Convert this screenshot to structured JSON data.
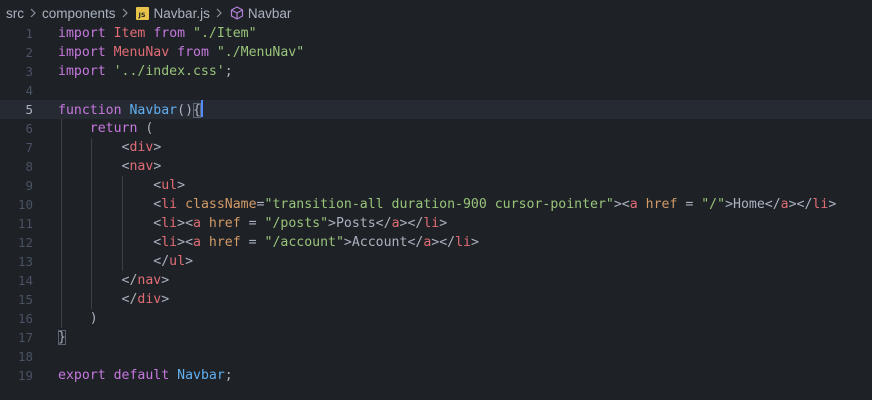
{
  "breadcrumb": {
    "segments": [
      "src",
      "components",
      "Navbar.js",
      "Navbar"
    ],
    "file_icon_text": "JS",
    "file_icon_name": "javascript-file-icon",
    "symbol_icon_name": "component-cube-icon"
  },
  "colors": {
    "background": "#1e2227",
    "keyword": "#c678dd",
    "function": "#61afef",
    "string": "#98c379",
    "tag": "#e06c75",
    "attribute": "#d19a66",
    "text": "#abb2bf",
    "line_number": "#495162"
  },
  "editor": {
    "language": "javascript",
    "current_line": 5,
    "lines": [
      {
        "n": "1",
        "tokens": [
          {
            "t": "import",
            "k": "kw"
          },
          {
            "t": " "
          },
          {
            "t": "Item",
            "k": "var"
          },
          {
            "t": " "
          },
          {
            "t": "from",
            "k": "kw"
          },
          {
            "t": " "
          },
          {
            "t": "\"./Item\"",
            "k": "str"
          }
        ]
      },
      {
        "n": "2",
        "tokens": [
          {
            "t": "import",
            "k": "kw"
          },
          {
            "t": " "
          },
          {
            "t": "MenuNav",
            "k": "var"
          },
          {
            "t": " "
          },
          {
            "t": "from",
            "k": "kw"
          },
          {
            "t": " "
          },
          {
            "t": "\"./MenuNav\"",
            "k": "str"
          }
        ]
      },
      {
        "n": "3",
        "tokens": [
          {
            "t": "import",
            "k": "kw"
          },
          {
            "t": " "
          },
          {
            "t": "'../index.css'",
            "k": "str"
          },
          {
            "t": ";"
          }
        ]
      },
      {
        "n": "4",
        "tokens": []
      },
      {
        "n": "5",
        "tokens": [
          {
            "t": "function",
            "k": "kw"
          },
          {
            "t": " "
          },
          {
            "t": "Navbar",
            "k": "fn"
          },
          {
            "t": "()"
          },
          {
            "t": "{",
            "k": "bm"
          },
          {
            "t": "",
            "k": "cursor"
          }
        ]
      },
      {
        "n": "6",
        "tokens": [
          {
            "t": "    "
          },
          {
            "t": "return",
            "k": "kw"
          },
          {
            "t": " ("
          }
        ]
      },
      {
        "n": "7",
        "tokens": [
          {
            "t": "        "
          },
          {
            "t": "<"
          },
          {
            "t": "div",
            "k": "tag"
          },
          {
            "t": ">"
          }
        ]
      },
      {
        "n": "8",
        "tokens": [
          {
            "t": "        "
          },
          {
            "t": "<"
          },
          {
            "t": "nav",
            "k": "tag"
          },
          {
            "t": ">"
          }
        ]
      },
      {
        "n": "9",
        "tokens": [
          {
            "t": "            "
          },
          {
            "t": "<"
          },
          {
            "t": "ul",
            "k": "tag"
          },
          {
            "t": ">"
          }
        ]
      },
      {
        "n": "10",
        "tokens": [
          {
            "t": "            "
          },
          {
            "t": "<"
          },
          {
            "t": "li",
            "k": "tag"
          },
          {
            "t": " "
          },
          {
            "t": "className",
            "k": "attr"
          },
          {
            "t": "="
          },
          {
            "t": "\"transition-all duration-900 cursor-pointer\"",
            "k": "str"
          },
          {
            "t": "><"
          },
          {
            "t": "a",
            "k": "tag"
          },
          {
            "t": " "
          },
          {
            "t": "href",
            "k": "attr"
          },
          {
            "t": " = "
          },
          {
            "t": "\"/\"",
            "k": "str"
          },
          {
            "t": ">Home</"
          },
          {
            "t": "a",
            "k": "tag"
          },
          {
            "t": "></"
          },
          {
            "t": "li",
            "k": "tag"
          },
          {
            "t": ">"
          }
        ]
      },
      {
        "n": "11",
        "tokens": [
          {
            "t": "            "
          },
          {
            "t": "<"
          },
          {
            "t": "li",
            "k": "tag"
          },
          {
            "t": "><"
          },
          {
            "t": "a",
            "k": "tag"
          },
          {
            "t": " "
          },
          {
            "t": "href",
            "k": "attr"
          },
          {
            "t": " = "
          },
          {
            "t": "\"/posts\"",
            "k": "str"
          },
          {
            "t": ">Posts</"
          },
          {
            "t": "a",
            "k": "tag"
          },
          {
            "t": "></"
          },
          {
            "t": "li",
            "k": "tag"
          },
          {
            "t": ">"
          }
        ]
      },
      {
        "n": "12",
        "tokens": [
          {
            "t": "            "
          },
          {
            "t": "<"
          },
          {
            "t": "li",
            "k": "tag"
          },
          {
            "t": "><"
          },
          {
            "t": "a",
            "k": "tag"
          },
          {
            "t": " "
          },
          {
            "t": "href",
            "k": "attr"
          },
          {
            "t": " = "
          },
          {
            "t": "\"/account\"",
            "k": "str"
          },
          {
            "t": ">Account</"
          },
          {
            "t": "a",
            "k": "tag"
          },
          {
            "t": "></"
          },
          {
            "t": "li",
            "k": "tag"
          },
          {
            "t": ">"
          }
        ]
      },
      {
        "n": "13",
        "tokens": [
          {
            "t": "            "
          },
          {
            "t": "</"
          },
          {
            "t": "ul",
            "k": "tag"
          },
          {
            "t": ">"
          }
        ]
      },
      {
        "n": "14",
        "tokens": [
          {
            "t": "        "
          },
          {
            "t": "</"
          },
          {
            "t": "nav",
            "k": "tag"
          },
          {
            "t": ">"
          }
        ]
      },
      {
        "n": "15",
        "tokens": [
          {
            "t": "        "
          },
          {
            "t": "</"
          },
          {
            "t": "div",
            "k": "tag"
          },
          {
            "t": ">"
          }
        ]
      },
      {
        "n": "16",
        "tokens": [
          {
            "t": "    "
          },
          {
            "t": ")"
          }
        ]
      },
      {
        "n": "17",
        "tokens": [
          {
            "t": "}",
            "k": "bm"
          }
        ]
      },
      {
        "n": "18",
        "tokens": []
      },
      {
        "n": "19",
        "tokens": [
          {
            "t": "export",
            "k": "kw"
          },
          {
            "t": " "
          },
          {
            "t": "default",
            "k": "kw"
          },
          {
            "t": " "
          },
          {
            "t": "Navbar",
            "k": "fn"
          },
          {
            "t": ";"
          }
        ]
      }
    ]
  }
}
